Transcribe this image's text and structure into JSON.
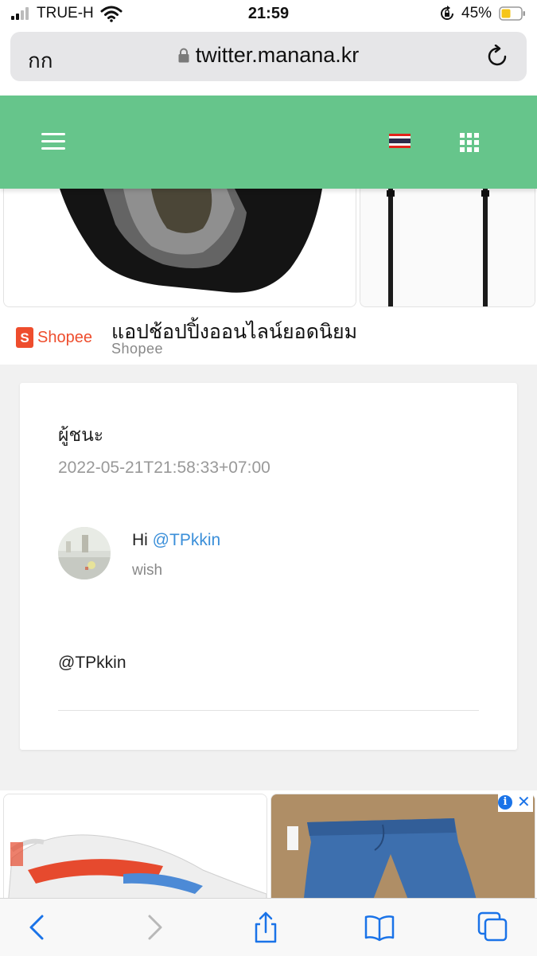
{
  "status_bar": {
    "carrier": "TRUE-H",
    "time": "21:59",
    "battery_percent": "45%",
    "icons": [
      "signal-icon",
      "wifi-icon",
      "orientation-lock-icon",
      "battery-icon"
    ]
  },
  "browser": {
    "text_size_label": "กก",
    "url": "twitter.manana.kr",
    "icons": [
      "padlock-icon",
      "reload-icon"
    ]
  },
  "header": {
    "icons": [
      "hamburger-menu-icon",
      "thai-flag-icon",
      "apps-grid-icon"
    ],
    "brand_color": "#66c58b"
  },
  "ad_top": {
    "brand_logo_text": "Shopee",
    "title": "แอปช้อปปิ้งออนไลน์ยอดนิยม",
    "source": "Shopee"
  },
  "card": {
    "title": "ผู้ชนะ",
    "date": "2022-05-21T21:58:33+07:00",
    "greeting_prefix": "Hi ",
    "mention": "@TPkkin",
    "subtext": "wish",
    "tag": "@TPkkin",
    "mention_color": "#3b8fd9"
  },
  "ad_bottom": {
    "icons": [
      "adchoices-info-icon",
      "ad-close-icon"
    ]
  },
  "toolbar": {
    "icons": [
      "back-icon",
      "forward-icon",
      "share-icon",
      "bookmarks-icon",
      "tabs-icon"
    ],
    "accent_color": "#1a73e8"
  }
}
